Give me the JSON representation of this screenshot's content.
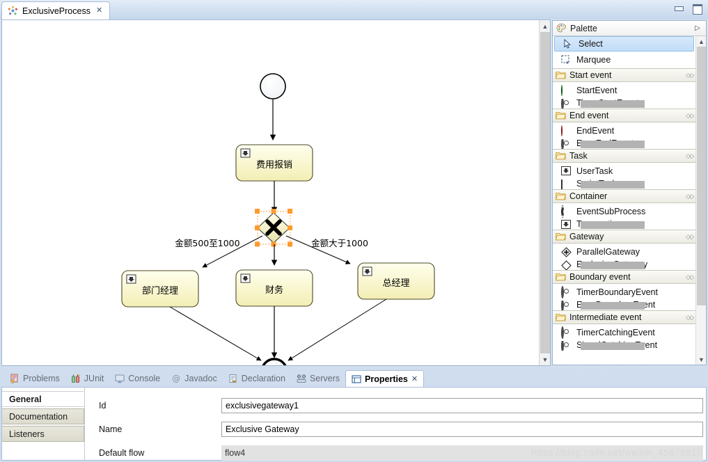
{
  "window": {
    "minimize_label": "Minimize",
    "maximize_label": "Maximize"
  },
  "editor_tab": {
    "title": "ExclusiveProcess",
    "close": "✕",
    "icon": "activiti-diagram-icon"
  },
  "palette": {
    "title": "Palette",
    "expand_icon": "▷",
    "tools": [
      {
        "label": "Select",
        "icon": "cursor-icon",
        "selected": true
      },
      {
        "label": "Marquee",
        "icon": "marquee-icon",
        "selected": false
      }
    ],
    "groups": [
      {
        "label": "Start event",
        "items": [
          {
            "label": "StartEvent",
            "icon": "green-circle-icon",
            "cut": false
          },
          {
            "label": "TimerStartEvent",
            "icon": "timer-icon",
            "cut": true
          }
        ]
      },
      {
        "label": "End event",
        "items": [
          {
            "label": "EndEvent",
            "icon": "red-circle-icon",
            "cut": false
          },
          {
            "label": "ErrorEndEvent",
            "icon": "error-icon",
            "cut": true
          }
        ]
      },
      {
        "label": "Task",
        "items": [
          {
            "label": "UserTask",
            "icon": "user-task-icon",
            "cut": false
          },
          {
            "label": "ScriptTask",
            "icon": "script-task-icon",
            "cut": true
          }
        ]
      },
      {
        "label": "Container",
        "items": [
          {
            "label": "EventSubProcess",
            "icon": "dashed-circle-icon",
            "cut": false
          },
          {
            "label": "Transaction",
            "icon": "transaction-icon",
            "cut": true
          }
        ]
      },
      {
        "label": "Gateway",
        "items": [
          {
            "label": "ParallelGateway",
            "icon": "parallel-gateway-icon",
            "cut": false
          },
          {
            "label": "ExclusiveGateway",
            "icon": "exclusive-gateway-icon",
            "cut": true
          }
        ]
      },
      {
        "label": "Boundary event",
        "items": [
          {
            "label": "TimerBoundaryEvent",
            "icon": "timer-boundary-icon",
            "cut": false
          },
          {
            "label": "ErrorBoundaryEvent",
            "icon": "error-boundary-icon",
            "cut": true
          }
        ]
      },
      {
        "label": "Intermediate event",
        "items": [
          {
            "label": "TimerCatchingEvent",
            "icon": "timer-catching-icon",
            "cut": false
          },
          {
            "label": "SignalCatchingEvent",
            "icon": "signal-catching-icon",
            "cut": true
          }
        ]
      }
    ]
  },
  "diagram": {
    "start_event": {
      "name": "",
      "shape": "circle"
    },
    "end_event": {
      "name": "",
      "shape": "thick-circle"
    },
    "tasks": [
      {
        "id": "usertask1",
        "label": "费用报销"
      },
      {
        "id": "usertask2",
        "label": "部门经理"
      },
      {
        "id": "usertask3",
        "label": "财务"
      },
      {
        "id": "usertask4",
        "label": "总经理"
      }
    ],
    "gateway": {
      "id": "exclusivegateway1",
      "label": "",
      "selected": true
    },
    "flow_labels": [
      {
        "text": "金额500至1000"
      },
      {
        "text": "金额大于1000"
      }
    ]
  },
  "bottom_tabs": [
    {
      "label": "Problems",
      "icon": "problems-icon",
      "active": false
    },
    {
      "label": "JUnit",
      "icon": "junit-icon",
      "active": false
    },
    {
      "label": "Console",
      "icon": "console-icon",
      "active": false
    },
    {
      "label": "Javadoc",
      "icon": "javadoc-icon",
      "active": false
    },
    {
      "label": "Declaration",
      "icon": "declaration-icon",
      "active": false
    },
    {
      "label": "Servers",
      "icon": "servers-icon",
      "active": false
    },
    {
      "label": "Properties",
      "icon": "properties-icon",
      "active": true,
      "close": "✕"
    }
  ],
  "properties": {
    "tabs": [
      {
        "label": "General",
        "active": true
      },
      {
        "label": "Documentation",
        "active": false
      },
      {
        "label": "Listeners",
        "active": false
      }
    ],
    "fields": [
      {
        "label": "Id",
        "value": "exclusivegateway1",
        "disabled": false
      },
      {
        "label": "Name",
        "value": "Exclusive Gateway",
        "disabled": false
      },
      {
        "label": "Default flow",
        "value": "flow4",
        "disabled": true
      }
    ]
  },
  "watermark": "https://blog.csdn.net/weixin_45879810",
  "colors": {
    "task_fill_top": "#ffffe8",
    "task_fill_bottom": "#f5f0b8",
    "selection_handle": "#ff9a2e",
    "accent_blue": "#c3ddf7"
  }
}
